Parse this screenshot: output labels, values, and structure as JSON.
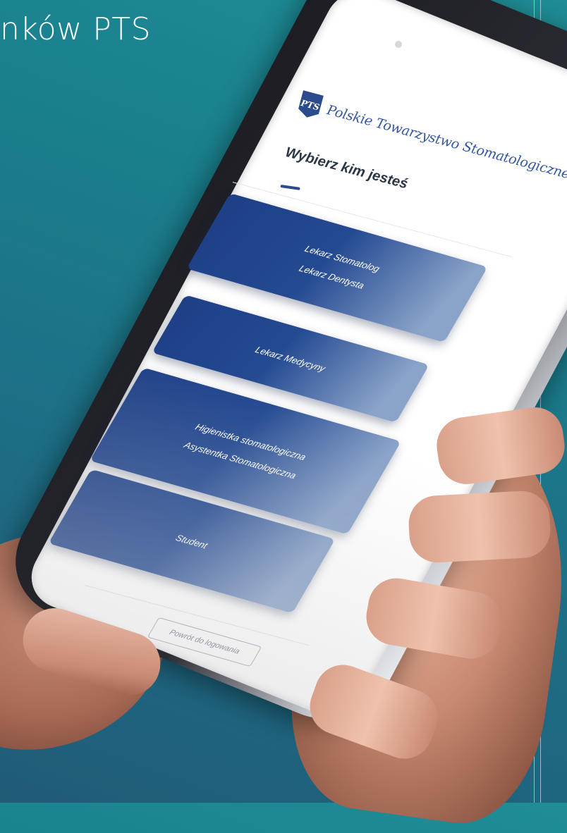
{
  "headline": "nków PTS",
  "app": {
    "logo_mark": "PTS",
    "logo_text": "Polskie Towarzystwo Stomatologiczne",
    "screen_title": "Wybierz kim jesteś",
    "roles": [
      {
        "lines": [
          "Lekarz Stomatolog",
          "Lekarz Dentysta"
        ]
      },
      {
        "lines": [
          "Lekarz Medycyny"
        ]
      },
      {
        "lines": [
          "Higienistka stomatologiczna",
          "Asystentka Stomatologiczna"
        ]
      },
      {
        "lines": [
          "Student"
        ]
      }
    ],
    "back_button": "Powrót do logowania"
  },
  "colors": {
    "background": "#1d7a8b",
    "accent": "#2b4c8c",
    "card_gradient_start": "#1d3f86",
    "card_gradient_end": "#8aa3c9"
  }
}
